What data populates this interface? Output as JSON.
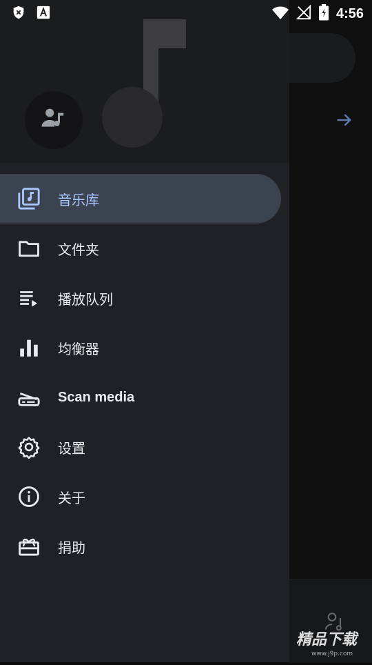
{
  "status_bar": {
    "time": "4:56",
    "icons": [
      "shield-x-icon",
      "font-a-icon",
      "wifi-icon",
      "signal-off-icon",
      "battery-charging-icon"
    ]
  },
  "drawer": {
    "header": {
      "avatar_icon": "account-music-icon",
      "art_icon": "music-note-icon"
    },
    "menu": [
      {
        "label": "音乐库",
        "icon": "library-music-icon",
        "active": true
      },
      {
        "label": "文件夹",
        "icon": "folder-icon",
        "active": false
      },
      {
        "label": "播放队列",
        "icon": "queue-icon",
        "active": false
      },
      {
        "label": "均衡器",
        "icon": "equalizer-icon",
        "active": false
      },
      {
        "label": "Scan media",
        "icon": "scanner-icon",
        "active": false
      },
      {
        "label": "设置",
        "icon": "settings-icon",
        "active": false
      },
      {
        "label": "关于",
        "icon": "info-icon",
        "active": false
      },
      {
        "label": "捐助",
        "icon": "gift-icon",
        "active": false
      }
    ]
  },
  "background": {
    "arrow_icon": "arrow-right-icon",
    "accent": "#5a79a8"
  },
  "watermark": {
    "text": "精品下载",
    "subtext": "www.j9p.com"
  }
}
